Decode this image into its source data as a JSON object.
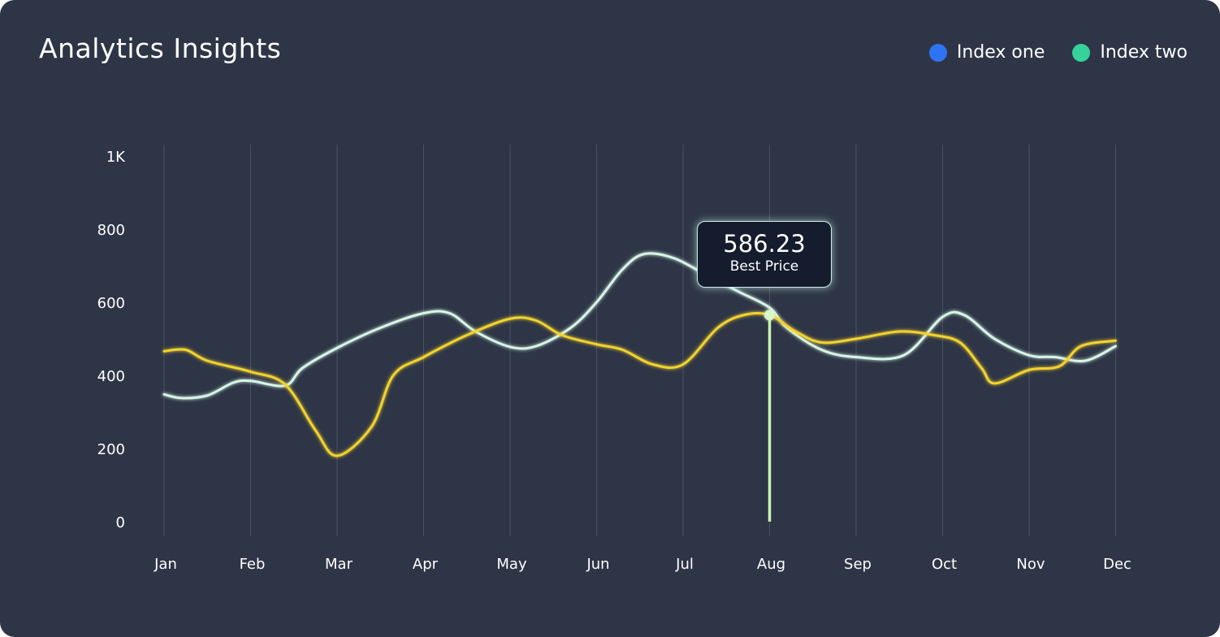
{
  "header": {
    "title": "Analytics Insights"
  },
  "legend": [
    {
      "label": "Index one",
      "color": "#2f73f5"
    },
    {
      "label": "Index two",
      "color": "#35d39a"
    }
  ],
  "tooltip": {
    "value": "586.23",
    "label": "Best Price"
  },
  "chart_data": {
    "type": "line",
    "categories": [
      "Jan",
      "Feb",
      "Mar",
      "Apr",
      "May",
      "Jun",
      "Jul",
      "Aug",
      "Sep",
      "Oct",
      "Nov",
      "Dec"
    ],
    "y_ticks": [
      "0",
      "200",
      "400",
      "600",
      "800",
      "1K"
    ],
    "ylim": [
      0,
      1000
    ],
    "grid": "vertical",
    "legend_position": "top-right",
    "line_colors": [
      "#f2d22e",
      "#d6f5e6"
    ],
    "series": [
      {
        "values": [
          [
            0,
            466
          ],
          [
            0.25,
            470
          ],
          [
            0.5,
            440
          ],
          [
            1,
            410
          ],
          [
            1.4,
            375
          ],
          [
            1.75,
            250
          ],
          [
            2,
            180
          ],
          [
            2.4,
            260
          ],
          [
            2.65,
            400
          ],
          [
            3,
            450
          ],
          [
            3.5,
            510
          ],
          [
            4,
            555
          ],
          [
            4.3,
            550
          ],
          [
            4.6,
            510
          ],
          [
            5,
            485
          ],
          [
            5.3,
            470
          ],
          [
            5.65,
            430
          ],
          [
            6,
            430
          ],
          [
            6.4,
            530
          ],
          [
            6.7,
            565
          ],
          [
            7,
            565
          ],
          [
            7.3,
            520
          ],
          [
            7.6,
            490
          ],
          [
            8,
            500
          ],
          [
            8.5,
            520
          ],
          [
            8.9,
            510
          ],
          [
            9.2,
            490
          ],
          [
            9.45,
            420
          ],
          [
            9.6,
            378
          ],
          [
            10,
            415
          ],
          [
            10.35,
            425
          ],
          [
            10.6,
            480
          ],
          [
            11,
            495
          ]
        ]
      },
      {
        "values": [
          [
            0,
            348
          ],
          [
            0.2,
            338
          ],
          [
            0.5,
            345
          ],
          [
            0.8,
            380
          ],
          [
            1,
            385
          ],
          [
            1.4,
            372
          ],
          [
            1.6,
            420
          ],
          [
            2,
            475
          ],
          [
            2.5,
            530
          ],
          [
            3,
            570
          ],
          [
            3.3,
            570
          ],
          [
            3.6,
            520
          ],
          [
            4,
            478
          ],
          [
            4.3,
            480
          ],
          [
            4.7,
            530
          ],
          [
            5,
            600
          ],
          [
            5.3,
            690
          ],
          [
            5.55,
            732
          ],
          [
            5.9,
            720
          ],
          [
            6.3,
            670
          ],
          [
            6.65,
            628
          ],
          [
            7,
            585
          ],
          [
            7.2,
            530
          ],
          [
            7.6,
            470
          ],
          [
            8,
            450
          ],
          [
            8.55,
            455
          ],
          [
            9,
            560
          ],
          [
            9.25,
            565
          ],
          [
            9.6,
            500
          ],
          [
            10,
            455
          ],
          [
            10.3,
            450
          ],
          [
            10.65,
            440
          ],
          [
            11,
            480
          ]
        ]
      }
    ],
    "highlight": {
      "x": "Aug",
      "y": 565
    }
  }
}
